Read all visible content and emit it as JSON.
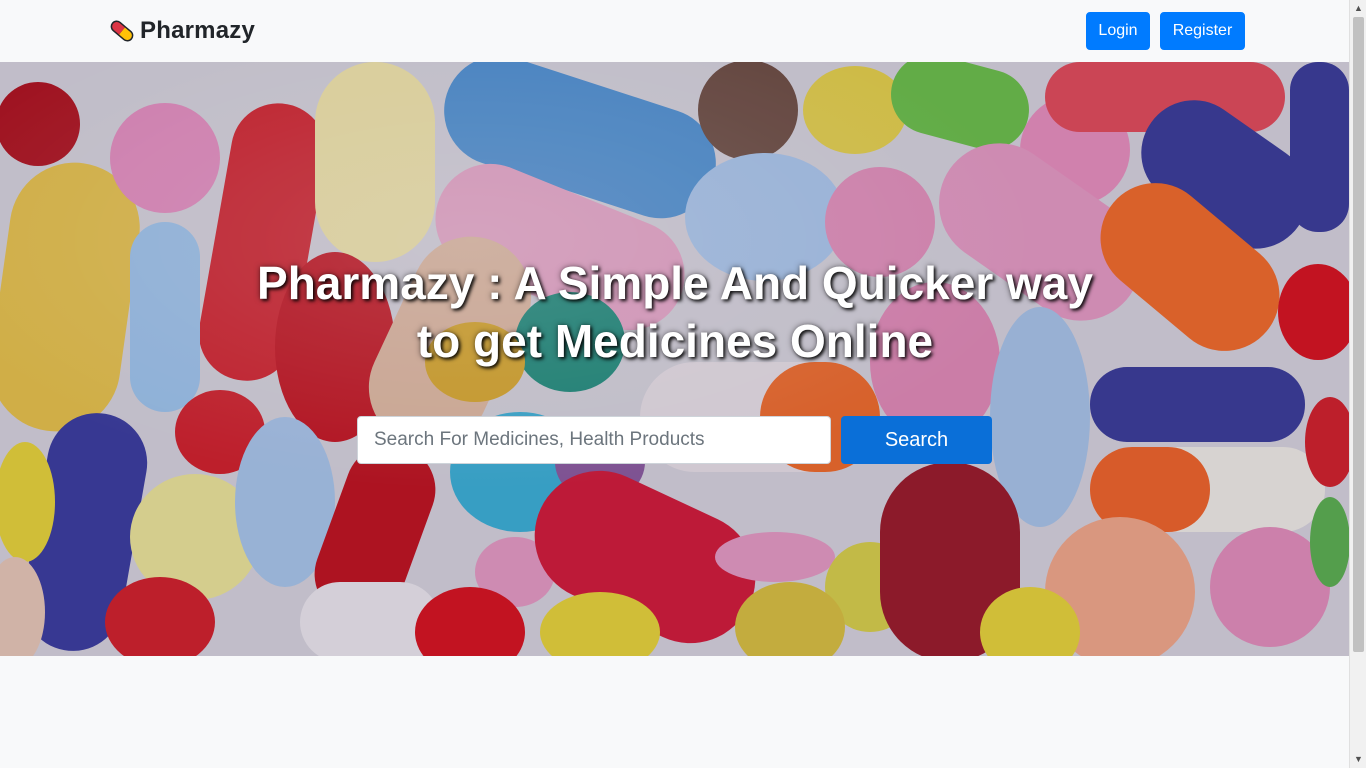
{
  "navbar": {
    "brand_name": "Pharmazy",
    "brand_icon": "pill-icon",
    "login_label": "Login",
    "register_label": "Register"
  },
  "hero": {
    "title_line1": "Pharmazy : A Simple And Quicker way",
    "title_line2": "to get Medicines Online",
    "background_image": "colorful-pills-and-capsules"
  },
  "search": {
    "placeholder": "Search For Medicines, Health Products",
    "value": "",
    "button_label": "Search"
  },
  "colors": {
    "primary": "#007bff",
    "search_button": "#0a6fd8",
    "page_background": "#f8f9fa",
    "brand_text": "#212529"
  }
}
